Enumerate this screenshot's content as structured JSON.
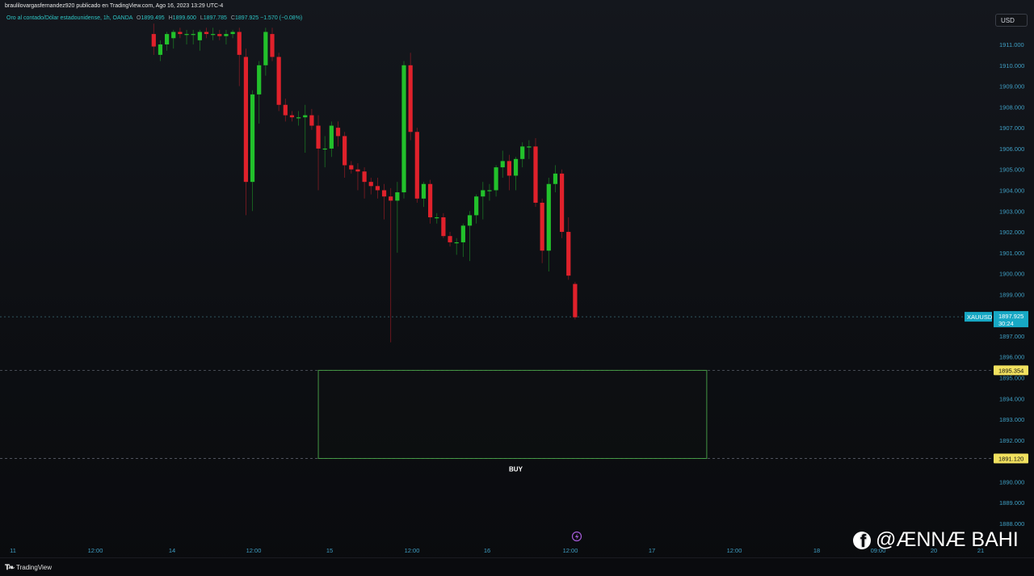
{
  "header": {
    "publish_line": "braulilovargasfernandez920 publicado en TradingView.com, Ago 16, 2023 13:29 UTC-4"
  },
  "legend": {
    "symbol_desc": "Oro al contado/Dólar estadounidense, 1h, OANDA",
    "o_label": "O",
    "o_value": "1899.495",
    "h_label": "H",
    "h_value": "1899.600",
    "l_label": "L",
    "l_value": "1897.785",
    "c_label": "C",
    "c_value": "1897.925",
    "change": "−1.570 (−0.08%)"
  },
  "currency_button": "USD",
  "chart_data": {
    "type": "candlestick",
    "symbol": "XAUUSD",
    "current_price": "1897.925",
    "countdown": "30:24",
    "price_ticks": [
      "1911.000",
      "1910.000",
      "1909.000",
      "1908.000",
      "1907.000",
      "1906.000",
      "1905.000",
      "1904.000",
      "1903.000",
      "1902.000",
      "1901.000",
      "1900.000",
      "1899.000",
      "1898.000",
      "1897.000",
      "1896.000",
      "1895.000",
      "1894.000",
      "1893.000",
      "1892.000",
      "1891.000",
      "1890.000",
      "1889.000",
      "1888.000"
    ],
    "time_ticks": [
      "11",
      "12:00",
      "14",
      "12:00",
      "15",
      "12:00",
      "16",
      "12:00",
      "17",
      "12:00",
      "18",
      "09:00",
      "20",
      "21"
    ],
    "ylim": [
      1887.8,
      1911.6
    ],
    "zone": {
      "top": 1895.354,
      "bottom": 1891.12,
      "top_label": "1895.354",
      "bottom_label": "1891.120",
      "text": "BUY",
      "start_index": 47,
      "end_index": 106
    },
    "candles": [
      {
        "o": 1911.5,
        "h": 1912.0,
        "l": 1910.5,
        "c": 1910.9
      },
      {
        "o": 1910.5,
        "h": 1911.2,
        "l": 1910.2,
        "c": 1911.0
      },
      {
        "o": 1911.0,
        "h": 1911.6,
        "l": 1910.7,
        "c": 1911.5
      },
      {
        "o": 1911.3,
        "h": 1911.7,
        "l": 1910.8,
        "c": 1911.6
      },
      {
        "o": 1911.6,
        "h": 1911.8,
        "l": 1911.3,
        "c": 1911.5
      },
      {
        "o": 1911.5,
        "h": 1911.7,
        "l": 1911.0,
        "c": 1911.5
      },
      {
        "o": 1911.5,
        "h": 1911.7,
        "l": 1911.0,
        "c": 1911.5
      },
      {
        "o": 1911.2,
        "h": 1911.7,
        "l": 1910.7,
        "c": 1911.6
      },
      {
        "o": 1911.6,
        "h": 1911.8,
        "l": 1911.3,
        "c": 1911.5
      },
      {
        "o": 1911.5,
        "h": 1911.8,
        "l": 1911.2,
        "c": 1911.5
      },
      {
        "o": 1911.5,
        "h": 1911.7,
        "l": 1911.2,
        "c": 1911.4
      },
      {
        "o": 1911.4,
        "h": 1911.7,
        "l": 1911.0,
        "c": 1911.5
      },
      {
        "o": 1911.5,
        "h": 1911.7,
        "l": 1911.3,
        "c": 1911.6
      },
      {
        "o": 1911.6,
        "h": 1911.8,
        "l": 1909.0,
        "c": 1910.5
      },
      {
        "o": 1910.4,
        "h": 1910.8,
        "l": 1902.8,
        "c": 1904.4
      },
      {
        "o": 1904.4,
        "h": 1908.8,
        "l": 1903.0,
        "c": 1908.6
      },
      {
        "o": 1908.6,
        "h": 1910.2,
        "l": 1907.2,
        "c": 1910.0
      },
      {
        "o": 1910.0,
        "h": 1911.8,
        "l": 1909.5,
        "c": 1911.6
      },
      {
        "o": 1911.5,
        "h": 1911.8,
        "l": 1910.2,
        "c": 1910.4
      },
      {
        "o": 1910.4,
        "h": 1910.6,
        "l": 1907.8,
        "c": 1908.1
      },
      {
        "o": 1908.1,
        "h": 1908.4,
        "l": 1907.3,
        "c": 1907.6
      },
      {
        "o": 1907.6,
        "h": 1907.8,
        "l": 1907.3,
        "c": 1907.5
      },
      {
        "o": 1907.5,
        "h": 1907.8,
        "l": 1907.1,
        "c": 1907.5
      },
      {
        "o": 1907.5,
        "h": 1908.1,
        "l": 1905.8,
        "c": 1907.6
      },
      {
        "o": 1907.6,
        "h": 1907.9,
        "l": 1906.9,
        "c": 1907.1
      },
      {
        "o": 1907.1,
        "h": 1907.6,
        "l": 1904.0,
        "c": 1906.0
      },
      {
        "o": 1906.0,
        "h": 1906.6,
        "l": 1905.1,
        "c": 1906.0
      },
      {
        "o": 1906.0,
        "h": 1907.3,
        "l": 1905.6,
        "c": 1907.1
      },
      {
        "o": 1907.0,
        "h": 1907.3,
        "l": 1906.1,
        "c": 1906.6
      },
      {
        "o": 1906.6,
        "h": 1906.8,
        "l": 1904.6,
        "c": 1905.2
      },
      {
        "o": 1905.2,
        "h": 1905.4,
        "l": 1904.8,
        "c": 1905.0
      },
      {
        "o": 1905.0,
        "h": 1905.3,
        "l": 1904.0,
        "c": 1904.9
      },
      {
        "o": 1904.9,
        "h": 1905.1,
        "l": 1903.6,
        "c": 1904.4
      },
      {
        "o": 1904.4,
        "h": 1904.6,
        "l": 1903.8,
        "c": 1904.2
      },
      {
        "o": 1904.2,
        "h": 1904.6,
        "l": 1903.6,
        "c": 1904.0
      },
      {
        "o": 1904.0,
        "h": 1904.3,
        "l": 1902.6,
        "c": 1903.7
      },
      {
        "o": 1903.7,
        "h": 1904.1,
        "l": 1896.7,
        "c": 1903.5
      },
      {
        "o": 1903.5,
        "h": 1904.4,
        "l": 1901.0,
        "c": 1903.9
      },
      {
        "o": 1903.9,
        "h": 1910.2,
        "l": 1903.6,
        "c": 1910.0
      },
      {
        "o": 1910.0,
        "h": 1910.6,
        "l": 1906.4,
        "c": 1906.8
      },
      {
        "o": 1906.8,
        "h": 1907.0,
        "l": 1903.4,
        "c": 1903.6
      },
      {
        "o": 1903.6,
        "h": 1904.4,
        "l": 1903.2,
        "c": 1904.3
      },
      {
        "o": 1904.3,
        "h": 1904.5,
        "l": 1902.4,
        "c": 1902.7
      },
      {
        "o": 1902.7,
        "h": 1902.9,
        "l": 1902.4,
        "c": 1902.7
      },
      {
        "o": 1902.7,
        "h": 1902.9,
        "l": 1901.7,
        "c": 1901.8
      },
      {
        "o": 1901.8,
        "h": 1902.0,
        "l": 1901.3,
        "c": 1901.5
      },
      {
        "o": 1901.5,
        "h": 1901.7,
        "l": 1900.9,
        "c": 1901.5
      },
      {
        "o": 1901.5,
        "h": 1902.4,
        "l": 1900.8,
        "c": 1902.3
      },
      {
        "o": 1902.3,
        "h": 1903.0,
        "l": 1900.6,
        "c": 1902.8
      },
      {
        "o": 1902.8,
        "h": 1903.8,
        "l": 1902.4,
        "c": 1903.7
      },
      {
        "o": 1903.7,
        "h": 1904.4,
        "l": 1902.6,
        "c": 1904.0
      },
      {
        "o": 1904.0,
        "h": 1904.3,
        "l": 1903.5,
        "c": 1904.0
      },
      {
        "o": 1904.0,
        "h": 1905.2,
        "l": 1903.7,
        "c": 1905.1
      },
      {
        "o": 1905.1,
        "h": 1905.9,
        "l": 1904.6,
        "c": 1905.4
      },
      {
        "o": 1905.4,
        "h": 1905.7,
        "l": 1904.0,
        "c": 1904.7
      },
      {
        "o": 1904.7,
        "h": 1905.6,
        "l": 1904.0,
        "c": 1905.5
      },
      {
        "o": 1905.5,
        "h": 1906.3,
        "l": 1905.1,
        "c": 1906.1
      },
      {
        "o": 1906.1,
        "h": 1906.4,
        "l": 1905.5,
        "c": 1906.1
      },
      {
        "o": 1906.1,
        "h": 1906.5,
        "l": 1903.2,
        "c": 1903.4
      },
      {
        "o": 1903.4,
        "h": 1903.6,
        "l": 1900.5,
        "c": 1901.1
      },
      {
        "o": 1901.1,
        "h": 1904.6,
        "l": 1900.1,
        "c": 1904.3
      },
      {
        "o": 1904.3,
        "h": 1905.2,
        "l": 1903.9,
        "c": 1904.8
      },
      {
        "o": 1904.8,
        "h": 1905.0,
        "l": 1901.7,
        "c": 1902.0
      },
      {
        "o": 1902.0,
        "h": 1902.7,
        "l": 1899.7,
        "c": 1899.9
      },
      {
        "o": 1899.5,
        "h": 1899.6,
        "l": 1897.8,
        "c": 1897.9
      }
    ],
    "candle_indices": [
      22,
      23,
      24,
      25,
      26,
      27,
      28,
      29,
      30,
      31,
      32,
      33,
      34,
      35,
      36,
      37,
      38,
      39,
      40,
      41,
      42,
      43,
      44,
      45,
      46,
      47,
      48,
      49,
      50,
      51,
      52,
      53,
      54,
      55,
      56,
      57,
      58,
      59,
      60,
      61,
      62,
      63,
      64,
      65,
      66,
      67,
      68,
      69,
      70,
      71,
      72,
      73,
      74,
      75,
      76,
      77,
      78,
      79,
      80,
      81,
      82,
      83,
      84,
      85,
      86
    ]
  },
  "colors": {
    "up": "#22c12b",
    "down": "#e0212b",
    "axis_text": "#3f9fc4",
    "zone_border": "#4aa64a",
    "label_bg_yellow": "#f2e15f",
    "price_label_bg": "#17a8c4"
  },
  "footer": {
    "brand": "TradingView"
  },
  "watermark": {
    "text": "@ÆNNÆ BAHI",
    "icon": "facebook-icon"
  }
}
